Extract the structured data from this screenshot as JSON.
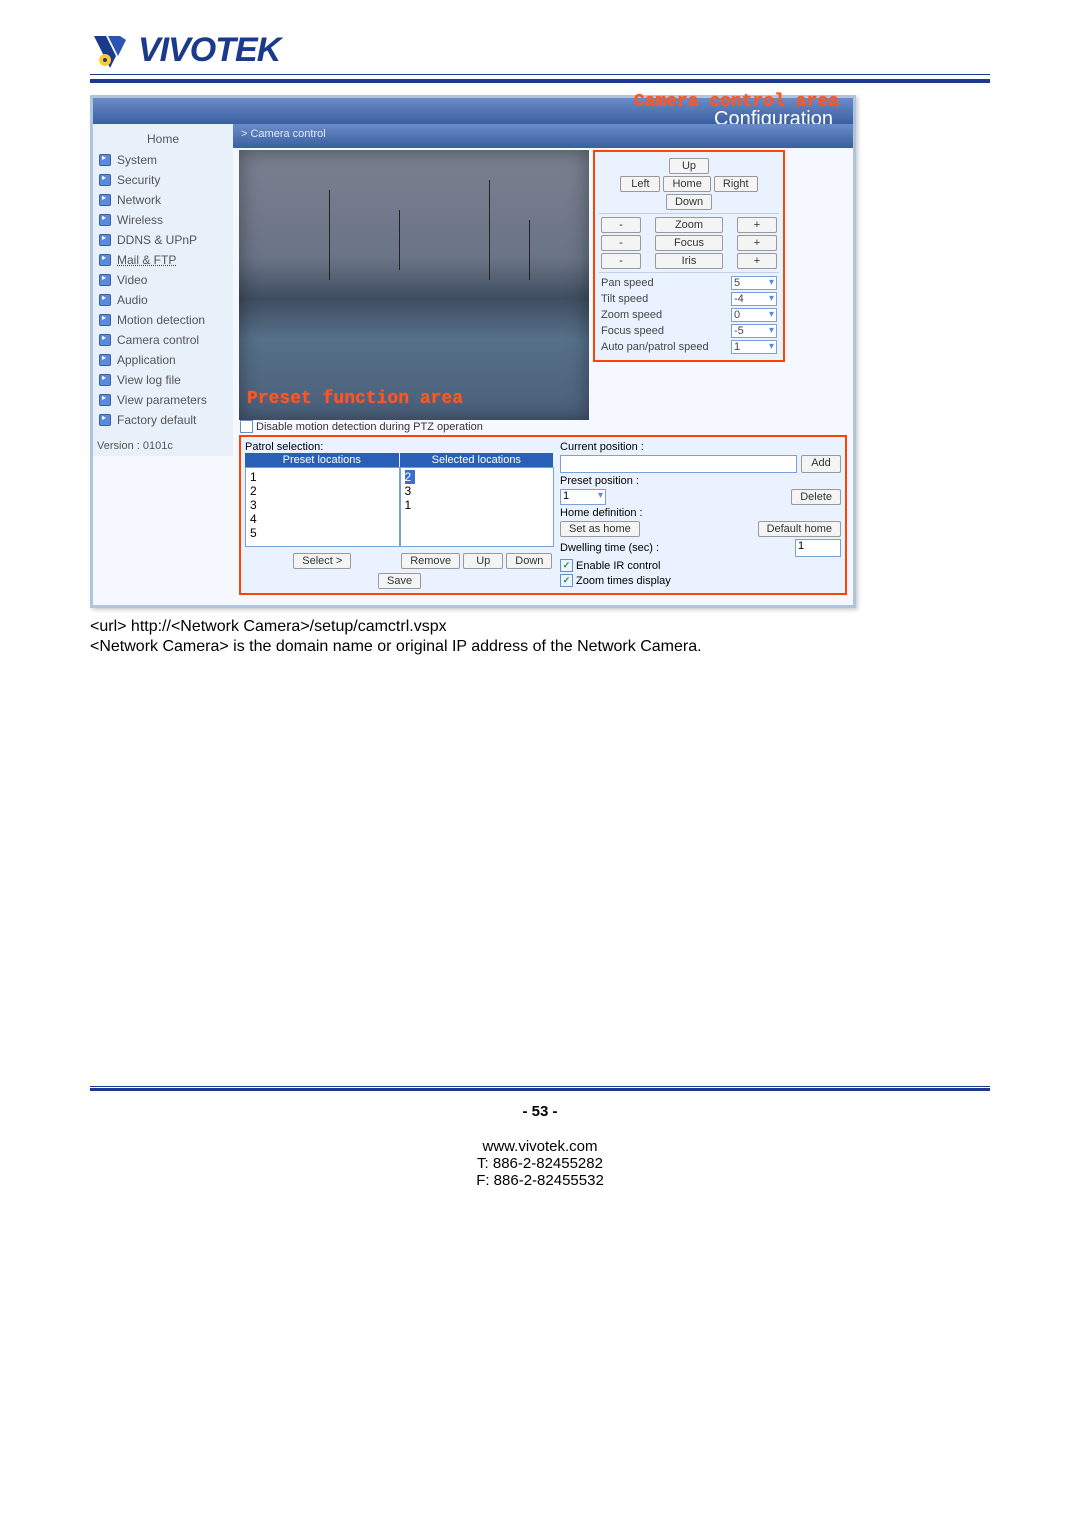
{
  "logo_text": "VIVOTEK",
  "screenshot": {
    "title": "Configuration",
    "breadcrumb": "> Camera control",
    "annotations": {
      "camera_control_area": "Camera control area",
      "preset_function_area": "Preset function area"
    },
    "sidebar": {
      "home": "Home",
      "items": [
        "System",
        "Security",
        "Network",
        "Wireless",
        "DDNS & UPnP",
        "Mail & FTP",
        "Video",
        "Audio",
        "Motion detection",
        "Camera control",
        "Application",
        "View log file",
        "View parameters",
        "Factory default"
      ],
      "underline_index": 5,
      "version_label": "Version : 0101c"
    },
    "ctrl": {
      "up": "Up",
      "left": "Left",
      "home": "Home",
      "right": "Right",
      "down": "Down",
      "minus": "-",
      "plus": "+",
      "zoom": "Zoom",
      "focus": "Focus",
      "iris": "Iris",
      "pan_speed_label": "Pan speed",
      "pan_speed_val": "5",
      "tilt_speed_label": "Tilt speed",
      "tilt_speed_val": "-4",
      "zoom_speed_label": "Zoom speed",
      "zoom_speed_val": "0",
      "focus_speed_label": "Focus speed",
      "focus_speed_val": "-5",
      "auto_label": "Auto pan/patrol speed",
      "auto_val": "1"
    },
    "disable_cb": "Disable motion detection during PTZ operation",
    "preset": {
      "patrol_selection": "Patrol selection:",
      "th_preset": "Preset locations",
      "th_selected": "Selected locations",
      "preset_items": [
        "1",
        "2",
        "3",
        "4",
        "5"
      ],
      "selected_items": [
        "2",
        "3",
        "1"
      ],
      "select_btn": "Select >",
      "remove_btn": "Remove",
      "up_btn": "Up",
      "down_btn": "Down",
      "current_position": "Current position :",
      "add_btn": "Add",
      "preset_position": "Preset position :",
      "preset_pos_val": "1",
      "delete_btn": "Delete",
      "home_def": "Home definition :",
      "set_home": "Set as home",
      "default_home": "Default home",
      "dwelling": "Dwelling time (sec) :",
      "dwelling_val": "1",
      "enable_ir": "Enable IR control",
      "zoom_times": "Zoom times display",
      "save_btn": "Save"
    }
  },
  "body_lines": {
    "l1": "<url>  http://<Network Camera>/setup/camctrl.vspx",
    "l2": "<Network Camera> is the domain name or original IP address of the Network Camera."
  },
  "footer": {
    "page": "- 53 -",
    "site": "www.vivotek.com",
    "tel": "T: 886-2-82455282",
    "fax": "F: 886-2-82455532"
  }
}
